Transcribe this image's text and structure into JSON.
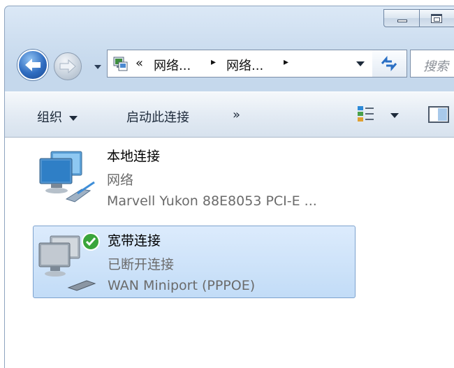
{
  "window": {
    "controls": [
      "minimize",
      "maximize"
    ]
  },
  "navigation": {
    "back_icon": "back-arrow-icon",
    "forward_icon": "forward-arrow-icon",
    "history_dropdown_icon": "chevron-down-icon"
  },
  "address_bar": {
    "overflow_glyph": "«",
    "parts": [
      "网络...",
      "网络..."
    ],
    "separator": "▸",
    "refresh_icon": "refresh-icon"
  },
  "search": {
    "placeholder": "搜索"
  },
  "toolbar": {
    "organize_label": "组织",
    "start_connection_label": "启动此连接",
    "more_label": "»",
    "view_icon": "change-view-icon",
    "pane_icon": "preview-pane-icon"
  },
  "connections": [
    {
      "name": "本地连接",
      "status": "网络",
      "device": "Marvell Yukon 88E8053 PCI-E ...",
      "icon": "lan-connection-icon",
      "selected": false
    },
    {
      "name": "宽带连接",
      "status": "已断开连接",
      "device": "WAN Miniport (PPPOE)",
      "icon": "broadband-connection-icon",
      "selected": true,
      "badge_icon": "green-check-icon"
    }
  ],
  "colors": {
    "selection_fill": "#c9e0f9",
    "selection_border": "#7da2ce",
    "secondary_text": "#6b6b6b",
    "accent_blue": "#2f6cc0"
  }
}
